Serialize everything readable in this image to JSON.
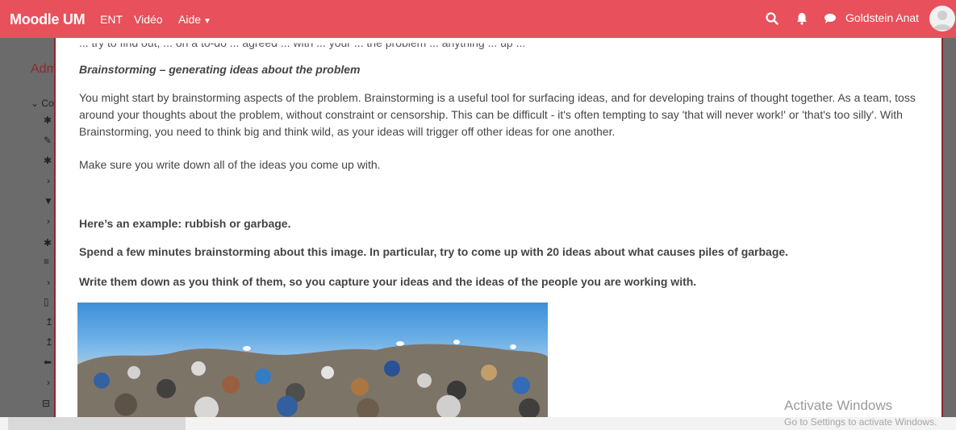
{
  "navbar": {
    "brand": "Moodle UM",
    "links": [
      "ENT",
      "Vidéo",
      "Aide"
    ],
    "user_name": "Goldstein Anat",
    "icons": [
      "search-icon",
      "bell-icon",
      "chat-icon",
      "avatar"
    ],
    "background_color": "#e8505b"
  },
  "sidebar": {
    "title_fragment": "Adm",
    "collapse_fragment": "Co"
  },
  "content": {
    "cut_top_line": "... try to find out, ... on a to-do ... agreed ... with ... your ... the problem ... anything ... up ...",
    "subheading": "Brainstorming – generating ideas about the problem",
    "paragraph1": "You might start by brainstorming aspects of the problem. Brainstorming is a useful tool for surfacing ideas, and for developing trains of thought together. As a team, toss around your thoughts about the problem, without constraint or censorship. This can be difficult - it's often tempting to say 'that will never work!' or 'that's too silly'.  With Brainstorming, you need to think big and think wild, as your ideas will trigger off other ideas for one another.",
    "paragraph2": "Make sure you write down all of the ideas you come up with.",
    "example_line": "Here’s an example:  rubbish or garbage.",
    "instruction1": "Spend a few minutes brainstorming about this image. In particular, try to come up with 20 ideas about what causes piles of garbage.",
    "instruction2": "Write them down as you think of them, so you capture your ideas and the ideas of the people you are working with.",
    "image_name": "garbage-pile-image"
  },
  "watermark": {
    "title": "Activate Windows",
    "subtitle": "Go to Settings to activate Windows."
  },
  "colors": {
    "accent": "#e8505b",
    "modal_border": "#8b2a30",
    "text": "#454545"
  }
}
